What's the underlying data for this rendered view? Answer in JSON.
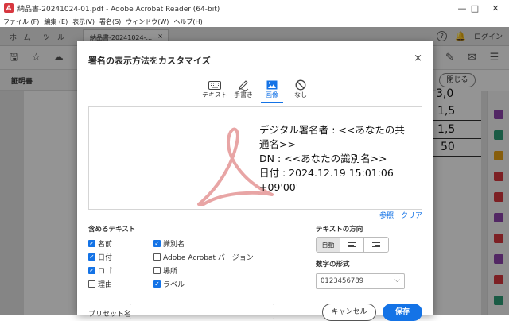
{
  "window": {
    "title": "納品書-20241024-01.pdf - Adobe Acrobat Reader (64-bit)",
    "minimize": "—",
    "maximize": "□",
    "close": "✕"
  },
  "menu": [
    "ファイル (F)",
    "編集 (E)",
    "表示(V)",
    "署名(S)",
    "ウィンドウ(W)",
    "ヘルプ(H)"
  ],
  "tabs": {
    "home": "ホーム",
    "tools": "ツール",
    "document": "納品書-20241024-...",
    "document_close": "×",
    "help": "?",
    "bell": "🔔",
    "login": "ログイン"
  },
  "subbar": {
    "label": "証明書",
    "close_button": "閉じる"
  },
  "document_numbers": [
    "3,0",
    "1,5",
    "1,5",
    "50"
  ],
  "dialog": {
    "title": "署名の表示方法をカスタマイズ",
    "close": "×",
    "modes": [
      {
        "label": "テキスト",
        "icon": "keyboard-icon"
      },
      {
        "label": "手書き",
        "icon": "pen-icon"
      },
      {
        "label": "画像",
        "icon": "image-icon"
      },
      {
        "label": "なし",
        "icon": "no-icon"
      }
    ],
    "active_mode": "画像",
    "preview_text": "デジタル署名者 : <<あなたの共\n通名>>\nDN : <<あなたの識別名>>\n日付 : 2024.12.19 15:01:06\n+09'00'",
    "links": {
      "browse": "参照",
      "clear": "クリア"
    },
    "include_label": "含めるテキスト",
    "checkboxes_left": [
      {
        "label": "名前",
        "checked": true
      },
      {
        "label": "日付",
        "checked": true
      },
      {
        "label": "ロゴ",
        "checked": true
      },
      {
        "label": "理由",
        "checked": false
      }
    ],
    "checkboxes_right": [
      {
        "label": "識別名",
        "checked": true
      },
      {
        "label": "Adobe Acrobat バージョン",
        "checked": false
      },
      {
        "label": "場所",
        "checked": false
      },
      {
        "label": "ラベル",
        "checked": true
      }
    ],
    "text_direction_label": "テキストの方向",
    "direction_auto": "自動",
    "number_format_label": "数字の形式",
    "number_format_value": "0123456789",
    "preset_label": "プリセット名",
    "cancel": "キャンセル",
    "save": "保存"
  },
  "colors": {
    "accent": "#1473e6",
    "acrobat_red": "#d7373f"
  }
}
